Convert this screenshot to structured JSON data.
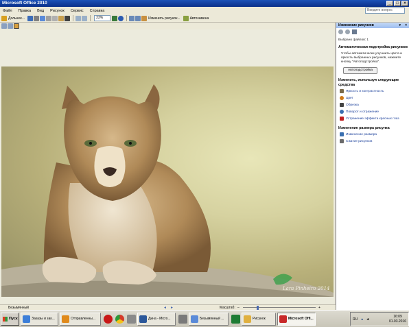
{
  "window": {
    "title": "Microsoft Office 2010"
  },
  "menu": [
    "Файл",
    "Правка",
    "Вид",
    "Рисунок",
    "Сервис",
    "Справка"
  ],
  "question_box": {
    "placeholder": "Введите вопрос"
  },
  "toolbar": {
    "zoom": "23%",
    "edit_pictures": "Изменить рисунок...",
    "autocorrect": "Автозамена",
    "file_btn": "Дольнее..."
  },
  "pane": {
    "title": "Изменение рисунков",
    "selected": "Выбрано файлов: 1",
    "auto_section": "Автоматическая подстройка рисунков",
    "auto_text": "Чтобы автоматически улучшить цвета и яркость выбранных рисунков, нажмите кнопку \"Автоподстройка\".",
    "auto_button": "Автоподстройка",
    "edit_section": "Изменить, используя следующие средства",
    "tools": [
      {
        "label": "Яркость и контрастность",
        "icon": "brightness-icon",
        "color": "#7a6a4a"
      },
      {
        "label": "Цвет",
        "icon": "color-icon",
        "color": "#d07a18"
      },
      {
        "label": "Обрезка",
        "icon": "crop-icon",
        "color": "#444444"
      },
      {
        "label": "Поворот и отражение",
        "icon": "rotate-icon",
        "color": "#3a6fb0"
      },
      {
        "label": "Устранение эффекта красных глаз",
        "icon": "redeye-icon",
        "color": "#c02020"
      }
    ],
    "resize_section": "Изменение размера рисунка",
    "resize_tools": [
      {
        "label": "Изменение размера",
        "icon": "resize-icon",
        "color": "#3a6fb0"
      },
      {
        "label": "Сжатие рисунков",
        "icon": "compress-icon",
        "color": "#6a6a6a"
      }
    ]
  },
  "status": {
    "filename": "Безымянный",
    "zoom_label": "Масштаб:"
  },
  "taskbar": {
    "start": "Пуск",
    "tasks": [
      {
        "label": "Заказы и зак...",
        "color": "#3d7ed8"
      },
      {
        "label": "Отправленны...",
        "color": "#e08a1c"
      },
      {
        "label": "",
        "color": "#c81818"
      },
      {
        "label": "",
        "color": "#2a9a3a"
      },
      {
        "label": "",
        "color": "#8a8a8a"
      },
      {
        "label": "Дина - Micro...",
        "color": "#2b579a"
      },
      {
        "label": "",
        "color": "#7a7a7a"
      },
      {
        "label": "Безымянный ...",
        "color": "#5a8ad8"
      },
      {
        "label": "",
        "color": "#1e7b34"
      },
      {
        "label": "Рисунок",
        "color": "#e0b040"
      },
      {
        "label": "Microsoft Offi...",
        "color": "#c82828"
      }
    ],
    "lang": "RU",
    "time": "16:09",
    "date": "01.03.2016"
  },
  "photo": {
    "watermark": "Lara Pinheiro 2014"
  }
}
